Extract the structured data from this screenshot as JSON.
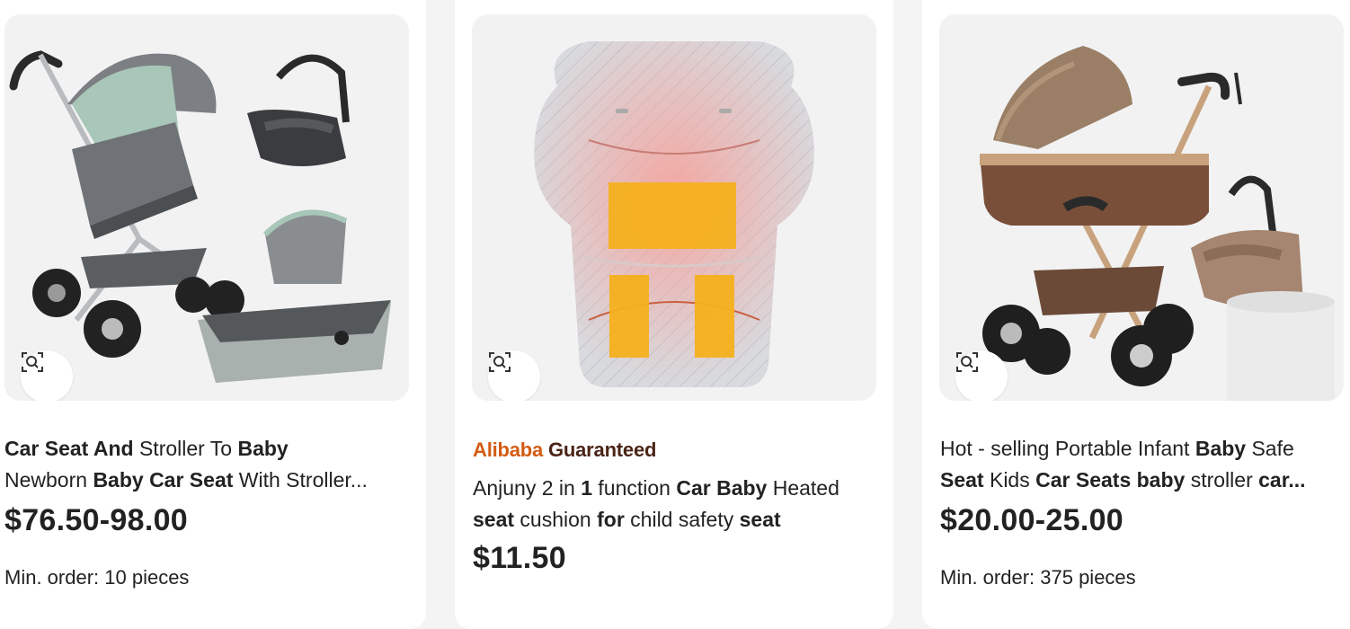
{
  "cards": [
    {
      "title_line1": [
        {
          "text": "Car Seat And",
          "bold": true
        },
        {
          "text": " Stroller To ",
          "bold": false
        },
        {
          "text": "Baby",
          "bold": true
        }
      ],
      "title_line2": [
        {
          "text": "Newborn ",
          "bold": false
        },
        {
          "text": "Baby Car Seat",
          "bold": true
        },
        {
          "text": " With Stroller...",
          "bold": false
        }
      ],
      "price": "$76.50-98.00",
      "moq": "Min. order: 10 pieces",
      "scan_icon": "image-search-icon"
    },
    {
      "badge_part1": "Alibaba",
      "badge_part2": "Guaranteed",
      "title_line1": [
        {
          "text": "Anjuny 2 in ",
          "bold": false
        },
        {
          "text": "1",
          "bold": true
        },
        {
          "text": " function ",
          "bold": false
        },
        {
          "text": "Car Baby",
          "bold": true
        },
        {
          "text": " Heated",
          "bold": false
        }
      ],
      "title_line2": [
        {
          "text": "seat",
          "bold": true
        },
        {
          "text": " cushion ",
          "bold": false
        },
        {
          "text": "for",
          "bold": true
        },
        {
          "text": " child safety ",
          "bold": false
        },
        {
          "text": "seat",
          "bold": true
        }
      ],
      "price": "$11.50",
      "scan_icon": "image-search-icon"
    },
    {
      "title_line1": [
        {
          "text": "Hot - selling Portable Infant ",
          "bold": false
        },
        {
          "text": "Baby",
          "bold": true
        },
        {
          "text": " Safe",
          "bold": false
        }
      ],
      "title_line2": [
        {
          "text": "Seat",
          "bold": true
        },
        {
          "text": " Kids ",
          "bold": false
        },
        {
          "text": "Car Seats baby",
          "bold": true
        },
        {
          "text": " stroller ",
          "bold": false
        },
        {
          "text": "car...",
          "bold": true
        }
      ],
      "price": "$20.00-25.00",
      "moq": "Min. order: 375 pieces",
      "scan_icon": "image-search-icon"
    }
  ],
  "colors": {
    "page_bg": "#f4f4f4",
    "card_bg": "#ffffff",
    "image_bg": "#f2f2f3",
    "guaranteed_orange": "#d35b12",
    "guaranteed_brown": "#4a2417",
    "text": "#222222"
  }
}
